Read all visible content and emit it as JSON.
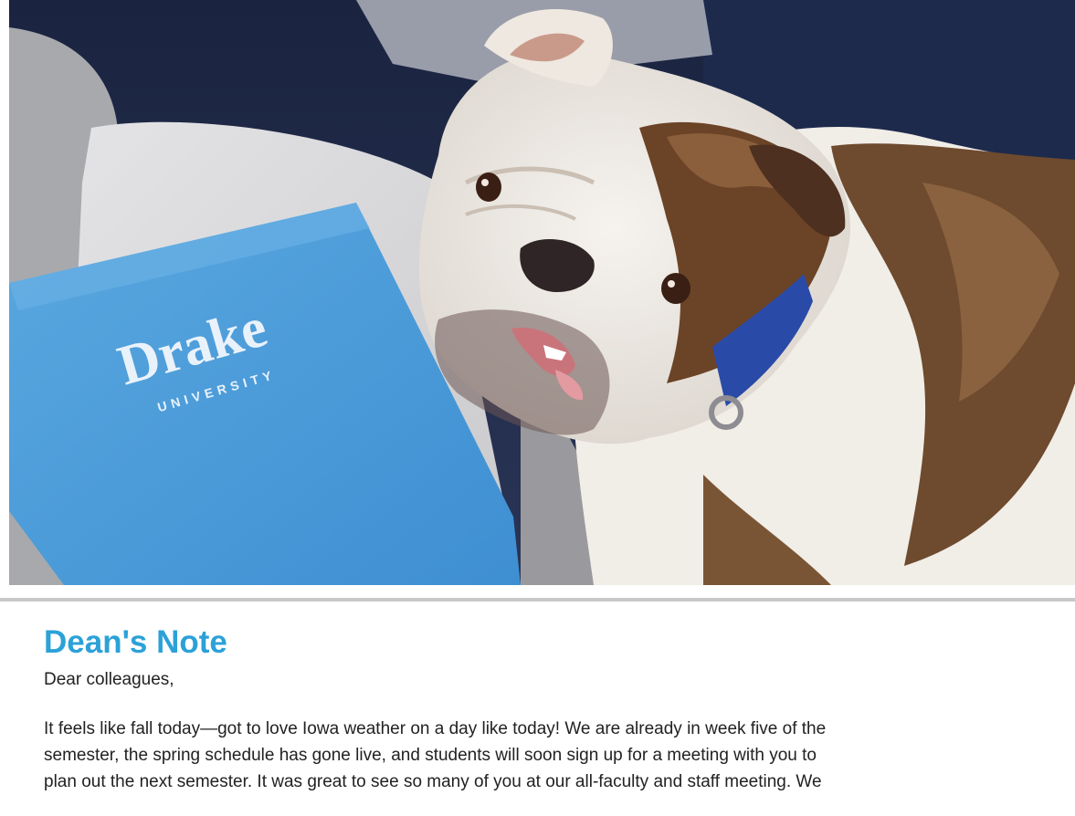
{
  "hero": {
    "alt": "English bulldog mascot beside a blue Drake University folder",
    "folder_brand": "Drake",
    "folder_sub": "UNIVERSITY"
  },
  "article": {
    "title": "Dean's Note",
    "salutation": "Dear colleagues,",
    "lines": [
      "It feels like fall today—got to love Iowa weather on a day like today!  We are already in week five of the",
      "semester, the spring schedule has gone live, and students will soon sign up for a meeting with you to",
      "plan out the next semester.  It was great to see so many of you at our all-faculty and staff meeting.  We"
    ]
  },
  "colors": {
    "title": "#2ca1d8",
    "folder": "#4a9ad8",
    "divider": "#c8c8c8"
  }
}
